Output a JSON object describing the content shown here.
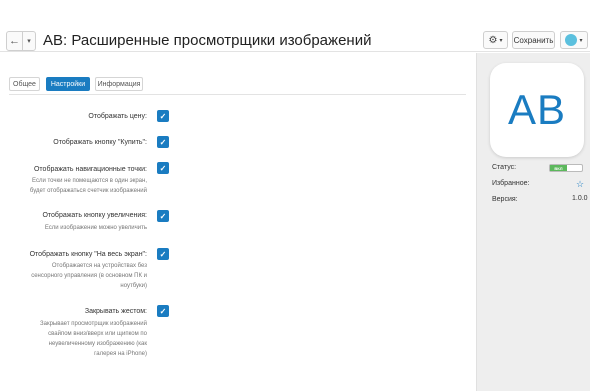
{
  "header": {
    "title": "AB: Расширенные просмотрщики изображений",
    "back_glyph": "←",
    "caret_glyph": "▾",
    "gear_glyph": "⚙",
    "save_label": "Сохранить"
  },
  "tabs": [
    {
      "label": "Общее",
      "active": false
    },
    {
      "label": "Настройки",
      "active": true
    },
    {
      "label": "Информация",
      "active": false
    }
  ],
  "settings": [
    {
      "label": "Отображать цену:",
      "help": "",
      "checked": true
    },
    {
      "label": "Отображать кнопку \"Купить\":",
      "help": "",
      "checked": true
    },
    {
      "label": "Отображать навигационные точки:",
      "help": "Если точки не помещаются в один экран, будет отображаться счетчик изображений",
      "checked": true
    },
    {
      "label": "Отображать кнопку увеличения:",
      "help": "Если изображение можно увеличить",
      "checked": true
    },
    {
      "label": "Отображать кнопку \"На весь экран\":",
      "help": "Отображается на устройствах без сенсорного управления (в основном ПК и ноутбуки)",
      "checked": true
    },
    {
      "label": "Закрывать жестом:",
      "help": "Закрывает просмотрщик изображений свайпом вниз/вверх или щипком по неувеличенному изображению (как галерея на iPhone)",
      "checked": true
    }
  ],
  "checkmark_glyph": "✓",
  "addon": {
    "logo_text": "AB",
    "status_label": "Статус:",
    "status_value": "ВКЛ",
    "favorite_label": "Избранное:",
    "favorite_glyph": "☆",
    "version_label": "Версия:",
    "version_value": "1.0.0"
  },
  "colors": {
    "accent": "#1a7cc1",
    "status_on": "#5cb85c",
    "panel_bg": "#eeeeee"
  }
}
